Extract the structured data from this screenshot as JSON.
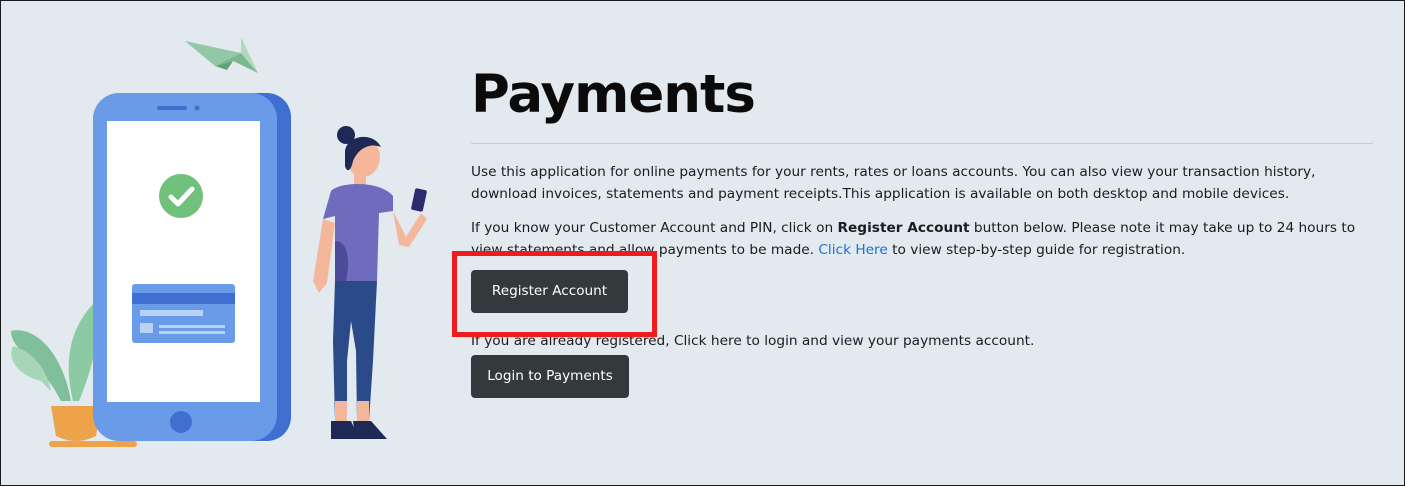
{
  "page": {
    "title": "Payments",
    "intro": "Use this application for online payments for your rents, rates or loans accounts. You can also view your transaction history, download invoices, statements and payment receipts.This application is available on both desktop and mobile devices.",
    "register_info_prefix": "If you know your Customer Account and PIN, click on ",
    "register_info_bold": "Register Account",
    "register_info_middle": " button below. Please note it may take up to 24 hours to view statements and allow payments to be made. ",
    "register_info_link": "Click Here",
    "register_info_suffix": " to view step-by-step guide for registration.",
    "register_button": "Register Account",
    "login_info": "If you are already registered, Click here to login and view your payments account.",
    "login_button": "Login to Payments"
  },
  "illustration": {
    "icons": [
      "paper-plane-icon",
      "smartphone-icon",
      "checkmark-icon",
      "credit-card-icon",
      "plant-icon",
      "woman-figure"
    ]
  },
  "colors": {
    "background": "#e2e9ef",
    "button": "#343a3c",
    "link": "#1f6fd6",
    "highlight": "#ee1c1c",
    "phone": "#5b8de0",
    "check": "#6fc17c"
  }
}
